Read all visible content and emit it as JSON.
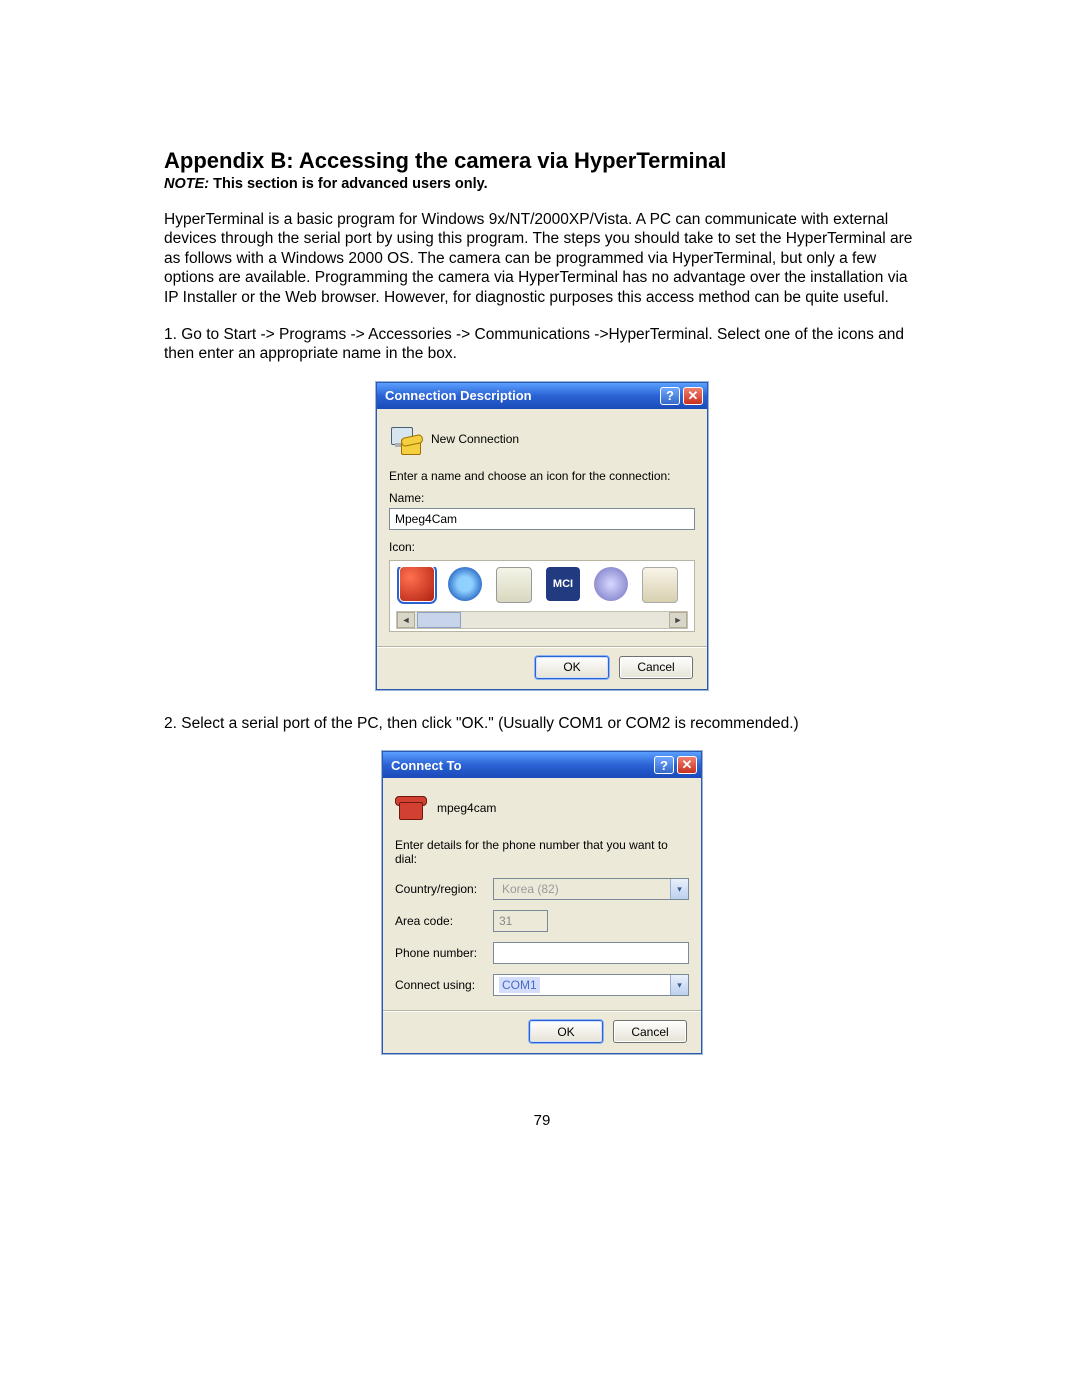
{
  "heading": "Appendix B: Accessing the camera via HyperTerminal",
  "note_label": "NOTE:",
  "note_text": " This section is for advanced users only.",
  "para1": "HyperTerminal is a basic program for Windows 9x/NT/2000XP/Vista. A PC can communicate with external devices through the serial port by using this program. The steps you should take to set the HyperTerminal are as follows with a Windows 2000 OS. The camera can be programmed via HyperTerminal, but only a few options are available. Programming the camera via HyperTerminal has no advantage over the installation via IP Installer or the Web browser. However, for diagnostic purposes this access method can be quite useful.",
  "step1": "1. Go to Start -> Programs -> Accessories -> Communications ->HyperTerminal. Select one of the icons and then enter an appropriate name in the box.",
  "step2": "2. Select a serial port of the PC, then click \"OK.\" (Usually COM1 or COM2 is recommended.)",
  "dialog1": {
    "title": "Connection Description",
    "header_text": "New Connection",
    "prompt": "Enter a name and choose an icon for the connection:",
    "name_label": "Name:",
    "name_value": "Mpeg4Cam",
    "icon_label": "Icon:",
    "mci_text": "MCI",
    "ok": "OK",
    "cancel": "Cancel"
  },
  "dialog2": {
    "title": "Connect To",
    "header_text": "mpeg4cam",
    "prompt": "Enter details for the phone number that you want to dial:",
    "country_label": "Country/region:",
    "country_value": "Korea (82)",
    "area_label": "Area code:",
    "area_value": "31",
    "phone_label": "Phone number:",
    "phone_value": "",
    "connect_label": "Connect using:",
    "connect_value": "COM1",
    "ok": "OK",
    "cancel": "Cancel"
  },
  "page_number": "79"
}
